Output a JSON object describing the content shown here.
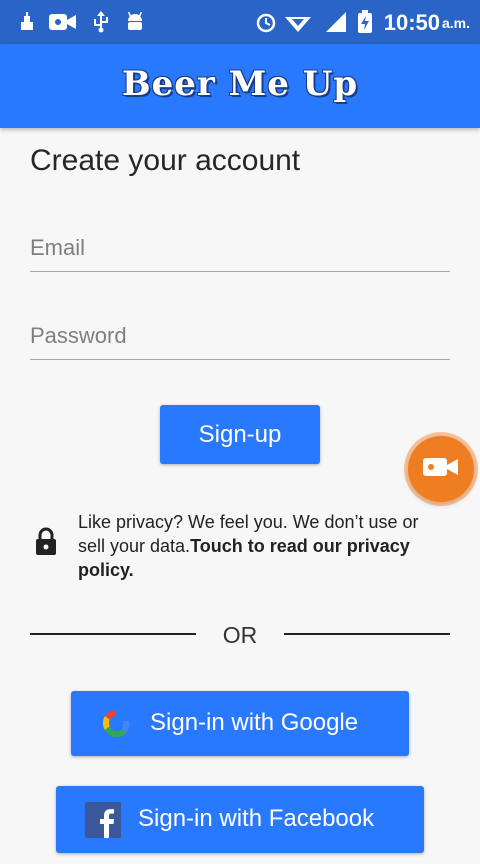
{
  "status_bar": {
    "time": "10:50",
    "ampm": "a.m.",
    "icons": [
      "notification-icon",
      "video-icon",
      "usb-icon",
      "android-icon",
      "alarm-icon",
      "wifi-icon",
      "signal-icon",
      "battery-charging-icon"
    ]
  },
  "app_bar": {
    "title": "Beer Me Up"
  },
  "form": {
    "heading": "Create your account",
    "email_placeholder": "Email",
    "email_value": "",
    "password_placeholder": "Password",
    "password_value": "",
    "signup_label": "Sign-up"
  },
  "privacy": {
    "text": "Like privacy? We feel you. We don’t use or sell your data.",
    "link": "Touch to read our privacy policy."
  },
  "divider": {
    "text": "OR"
  },
  "social": {
    "google_label": "Sign-in with Google",
    "facebook_label": "Sign-in with Facebook"
  },
  "colors": {
    "status_bar": "#2a64c6",
    "app_bar": "#2979ff",
    "button": "#2979ff",
    "fab": "#ef7d22",
    "background": "#f7f7f7"
  }
}
